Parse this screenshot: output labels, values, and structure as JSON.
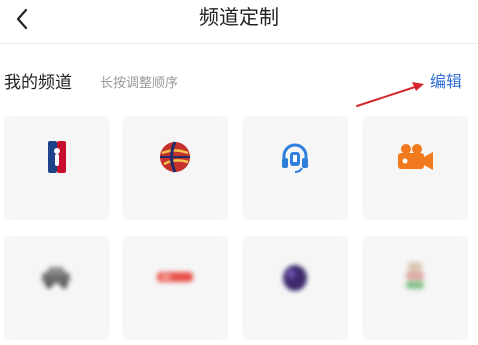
{
  "header": {
    "title": "频道定制",
    "back_icon": "chevron-left-icon"
  },
  "section": {
    "title": "我的频道",
    "hint": "长按调整顺序",
    "edit_label": "编辑"
  },
  "annotation": {
    "arrow_color": "#d6262b",
    "arrow_icon": "red-arrow-icon"
  },
  "colors": {
    "accent": "#2f6fd3",
    "card_bg": "#f6f6f6"
  },
  "channels": [
    {
      "icon": "nba-logo-icon",
      "label": ""
    },
    {
      "icon": "basketball-icon",
      "label": ""
    },
    {
      "icon": "headset-icon",
      "label": ""
    },
    {
      "icon": "video-camera-icon",
      "label": ""
    },
    {
      "icon": "car-icon",
      "label": ""
    },
    {
      "icon": "red-badge-icon",
      "label": ""
    },
    {
      "icon": "purple-ball-icon",
      "label": ""
    },
    {
      "icon": "shoe-icon",
      "label": ""
    }
  ]
}
